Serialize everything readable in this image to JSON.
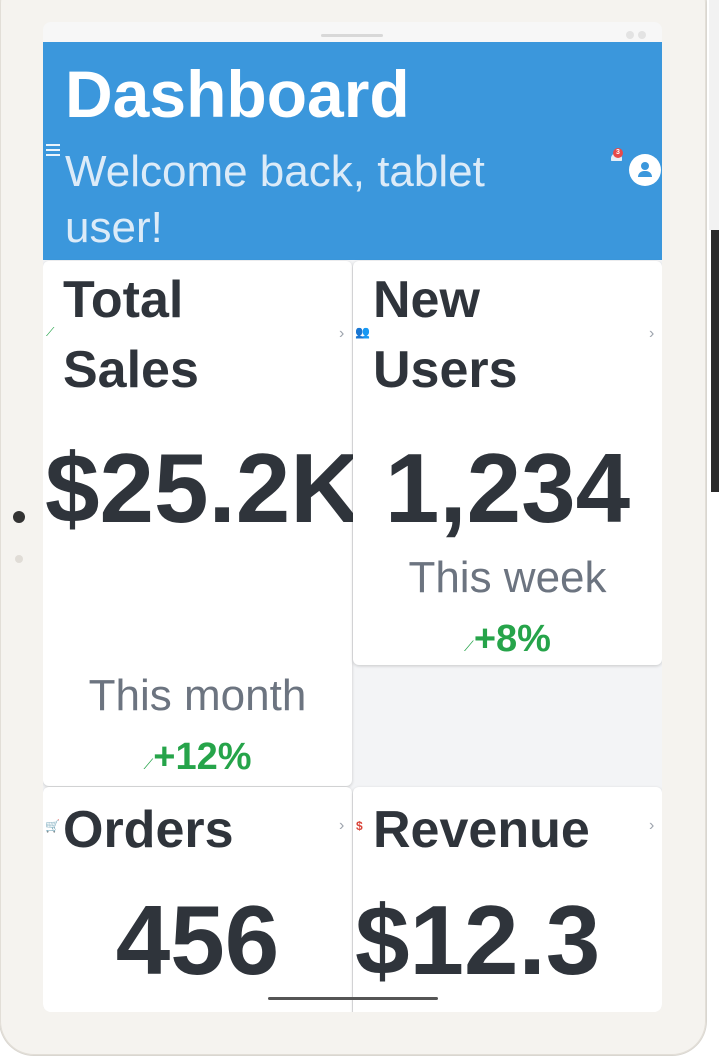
{
  "header": {
    "title": "Dashboard",
    "subtitle": "Welcome back, tablet user!",
    "notification_count": "3"
  },
  "cards": {
    "sales": {
      "label": "Total Sales",
      "value": "$25.2K",
      "sub": "This month",
      "delta": "+12%",
      "icon": "trending-up-icon"
    },
    "users": {
      "label": "New Users",
      "value": "1,234",
      "sub": "This week",
      "delta": "+8%",
      "icon": "people-icon"
    },
    "orders": {
      "label": "Orders",
      "value": "456",
      "icon": "cart-icon"
    },
    "revenue": {
      "label": "Revenue",
      "value": "$12.3",
      "icon": "dollar-icon"
    }
  },
  "chevron": "›",
  "trend_glyph": "⟋",
  "colors": {
    "header_bg": "#3b97dc",
    "positive": "#26a44a",
    "badge": "#e84a4a"
  }
}
